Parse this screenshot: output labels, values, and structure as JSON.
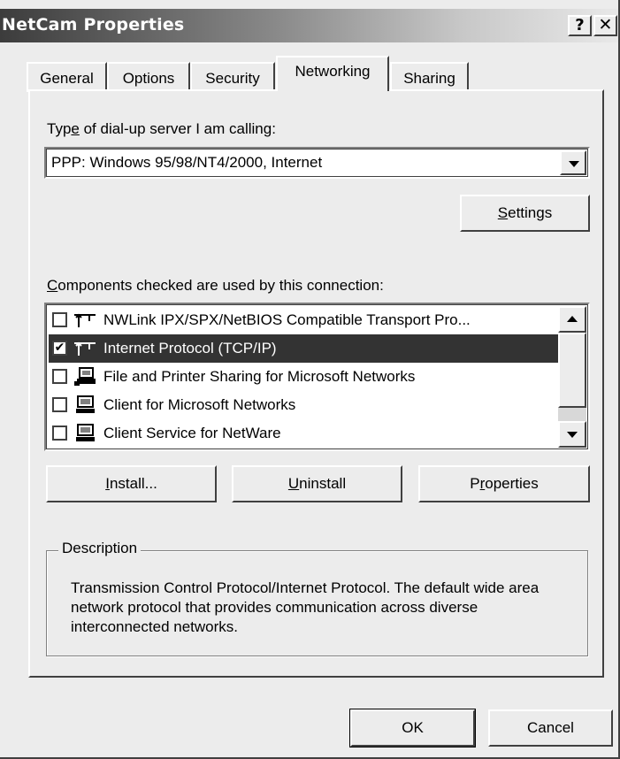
{
  "window": {
    "title": "NetCam Properties",
    "help_glyph": "?",
    "close_glyph": "✕"
  },
  "tabs": [
    {
      "label": "General",
      "active": false
    },
    {
      "label": "Options",
      "active": false
    },
    {
      "label": "Security",
      "active": false
    },
    {
      "label": "Networking",
      "active": true
    },
    {
      "label": "Sharing",
      "active": false
    }
  ],
  "server_type": {
    "label_prefix": "Typ",
    "label_accel": "e",
    "label_suffix": " of dial-up server I am calling:",
    "value": "PPP: Windows 95/98/NT4/2000, Internet"
  },
  "settings_button": {
    "accel": "S",
    "rest": "ettings"
  },
  "components": {
    "label_accel": "C",
    "label_rest": "omponents checked are used by this connection:",
    "items": [
      {
        "label": "NWLink IPX/SPX/NetBIOS Compatible Transport Pro...",
        "checked": false,
        "icon": "protocol-icon",
        "selected": false
      },
      {
        "label": "Internet Protocol (TCP/IP)",
        "checked": true,
        "icon": "protocol-icon",
        "selected": true
      },
      {
        "label": "File and Printer Sharing for Microsoft Networks",
        "checked": false,
        "icon": "service-icon",
        "selected": false
      },
      {
        "label": "Client for Microsoft Networks",
        "checked": false,
        "icon": "client-icon",
        "selected": false
      },
      {
        "label": "Client Service for NetWare",
        "checked": false,
        "icon": "client-icon",
        "selected": false
      }
    ]
  },
  "component_buttons": {
    "install": {
      "accel": "I",
      "rest": "nstall..."
    },
    "uninstall": {
      "accel": "U",
      "rest": "ninstall"
    },
    "properties": {
      "prefix": "P",
      "accel": "r",
      "rest": "operties"
    }
  },
  "description": {
    "legend": "Description",
    "text": "Transmission Control Protocol/Internet Protocol. The default wide area network protocol that provides communication across diverse interconnected networks."
  },
  "dialog_buttons": {
    "ok": "OK",
    "cancel": "Cancel"
  },
  "check_glyph": "✔",
  "colors": {
    "selection_bg": "#333333",
    "face": "#ececec"
  }
}
